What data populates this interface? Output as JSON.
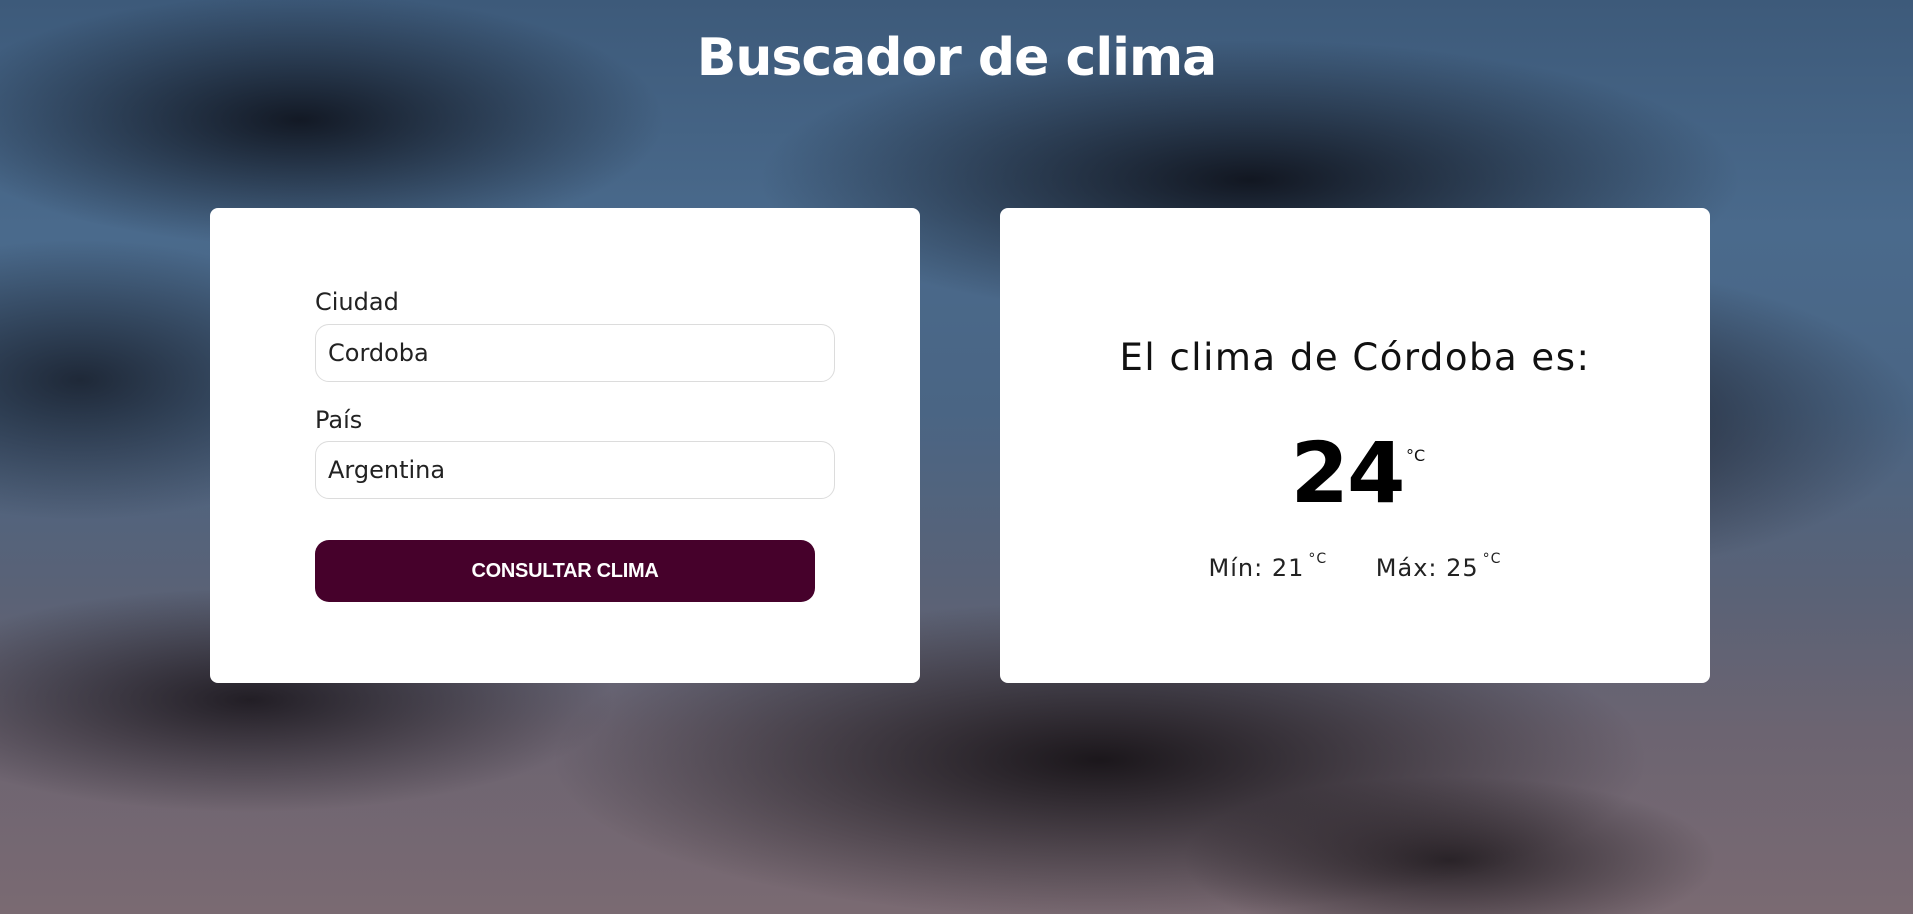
{
  "header": {
    "title": "Buscador de clima"
  },
  "form": {
    "city_label": "Ciudad",
    "city_value": "Cordoba",
    "country_label": "País",
    "country_value": "Argentina",
    "submit_label": "CONSULTAR CLIMA"
  },
  "result": {
    "heading": "El clima de Córdoba es:",
    "temperature": "24",
    "unit": "°C",
    "min_label": "Mín: 21",
    "min_unit": "°C",
    "max_label": "Máx: 25",
    "max_unit": "°C"
  },
  "colors": {
    "button_bg": "#46012b",
    "card_bg": "#ffffff",
    "title_text": "#ffffff"
  }
}
